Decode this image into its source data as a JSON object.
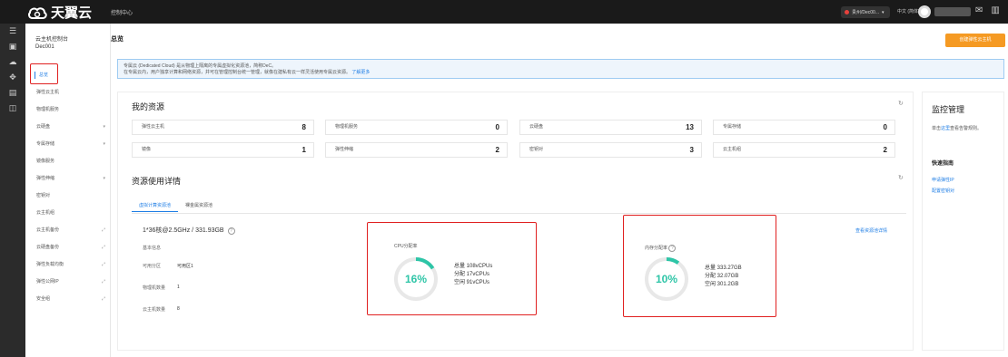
{
  "topbar": {
    "logo_text": "天翼云",
    "console_label": "控制中心",
    "region_label": "贵州/Dec00...",
    "language_label": "中文 (简体)",
    "icons": [
      "mail-icon",
      "chart-icon",
      "help-icon"
    ]
  },
  "rail": {
    "icons": [
      "menu-icon",
      "server-icon",
      "cloud-icon",
      "network-icon",
      "storage-icon",
      "monitor-icon"
    ]
  },
  "sidebar": {
    "title": "云主机控制台",
    "subtitle": "Dec001",
    "items": [
      {
        "label": "总览",
        "arrow": ""
      },
      {
        "label": "弹性云主机",
        "arrow": ""
      },
      {
        "label": "物理机服务",
        "arrow": ""
      },
      {
        "label": "云硬盘",
        "arrow": "▾"
      },
      {
        "label": "专属存储",
        "arrow": "▾"
      },
      {
        "label": "镜像服务",
        "arrow": ""
      },
      {
        "label": "弹性伸缩",
        "arrow": "▾"
      },
      {
        "label": "密钥对",
        "arrow": ""
      },
      {
        "label": "云主机组",
        "arrow": ""
      },
      {
        "label": "云主机备份",
        "arrow": "⤢"
      },
      {
        "label": "云硬盘备份",
        "arrow": "⤢"
      },
      {
        "label": "弹性负载均衡",
        "arrow": "⤢"
      },
      {
        "label": "弹性公网IP",
        "arrow": "⤢"
      },
      {
        "label": "安全组",
        "arrow": "⤢"
      }
    ]
  },
  "page": {
    "title": "总览",
    "create_button": "创建弹性云主机"
  },
  "notice": {
    "line1": "专属云 (Dedicated Cloud) 是从物理上隔离的专属虚拟化资源池，简称DeC。",
    "line2": "在专属云内，用户独享计算和网络资源，并可在管理控制台统一管理，就像在建私有云一样灵活使用专属云资源。",
    "link": "了解更多"
  },
  "resources": {
    "title": "我的资源",
    "items": [
      {
        "label": "弹性云主机",
        "count": "8"
      },
      {
        "label": "物理机服务",
        "count": "0"
      },
      {
        "label": "云硬盘",
        "count": "13"
      },
      {
        "label": "专属存储",
        "count": "0"
      },
      {
        "label": "镜像",
        "count": "1"
      },
      {
        "label": "弹性伸缩",
        "count": "2"
      },
      {
        "label": "密钥对",
        "count": "3"
      },
      {
        "label": "云主机组",
        "count": "2"
      }
    ]
  },
  "usage": {
    "title": "资源使用详情",
    "tabs": [
      "虚拟计算资源池",
      "裸金属资源池"
    ],
    "spec": "1*36核@2.5GHz / 331.93GB",
    "basic_info_label": "基本信息",
    "az_label": "可用分区",
    "az_value": "可用区1",
    "physical_label": "物理机数量",
    "physical_value": "1",
    "vm_label": "云主机数量",
    "vm_value": "8",
    "detail_link": "查看资源池详情",
    "cpu": {
      "title": "CPU分配率",
      "percent_label": "16%",
      "fraction": 0.16,
      "total": "总量 108vCPUs",
      "allocated": "分配 17vCPUs",
      "free": "空闲 91vCPUs"
    },
    "mem": {
      "title": "内存分配率",
      "percent_label": "10%",
      "fraction": 0.1,
      "total": "总量 333.27GB",
      "allocated": "分配 32.07GB",
      "free": "空闲 301.2GB"
    }
  },
  "right_panel": {
    "title": "监控管理",
    "text_pre": "单击",
    "text_link": "这里",
    "text_post": "查看告警规则。",
    "quick_title": "快速指南",
    "links": [
      "申请弹性IP",
      "配置密钥对"
    ]
  },
  "colors": {
    "accent": "#1f7ee5",
    "gauge": "#2ec5a7",
    "highlight": "#e02020",
    "create_button": "#f59a23"
  }
}
